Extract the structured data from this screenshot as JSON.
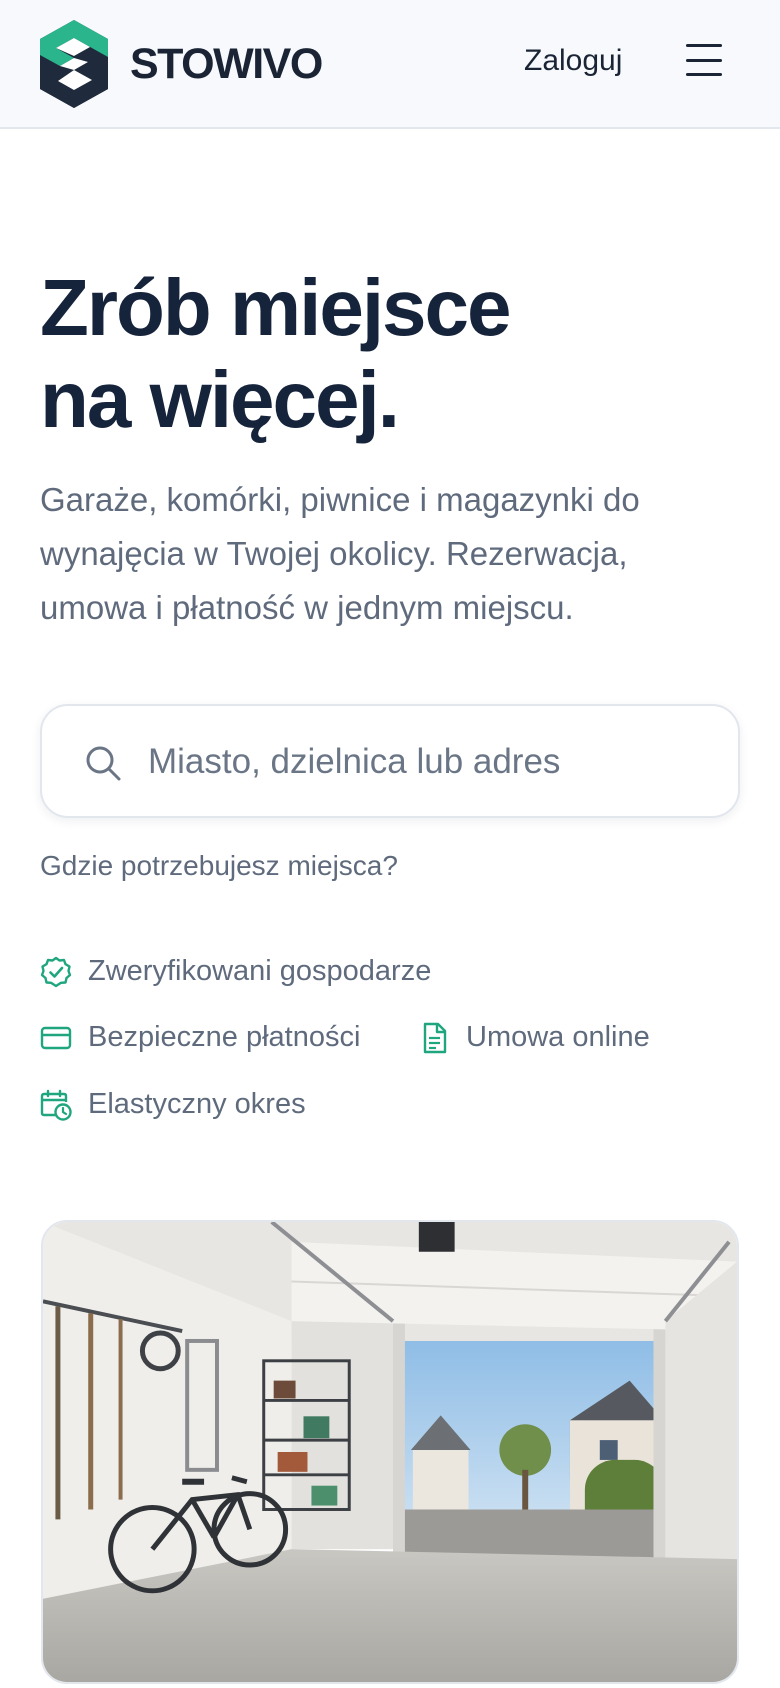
{
  "header": {
    "brand": "STOWIVO",
    "login_label": "Zaloguj",
    "logo_icon": "stowivo-logo-icon",
    "menu_icon": "hamburger-menu-icon"
  },
  "hero": {
    "headline_line1": "Zrób miejsce",
    "headline_line2": "na więcej.",
    "subtitle": "Garaże, komórki, piwnice i magazynki do wynajęcia w Twojej okolicy. Rezerwacja, umowa i płatność w jednym miejscu."
  },
  "search": {
    "placeholder": "Miasto, dzielnica lub adres",
    "value": "",
    "icon": "search-icon",
    "hint": "Gdzie potrzebujesz miejsca?"
  },
  "features": [
    {
      "label": "Zweryfikowani gospodarze",
      "icon": "verified-badge-icon"
    },
    {
      "label": "Bezpieczne płatności",
      "icon": "credit-card-icon"
    },
    {
      "label": "Umowa online",
      "icon": "document-icon"
    },
    {
      "label": "Elastyczny okres",
      "icon": "calendar-clock-icon"
    }
  ],
  "hero_image": {
    "description_icon": "garage-photo"
  },
  "colors": {
    "accent": "#20a67e",
    "text_dark": "#15233b",
    "text_muted": "#5f6b7d",
    "header_bg": "#f7f9fc"
  }
}
